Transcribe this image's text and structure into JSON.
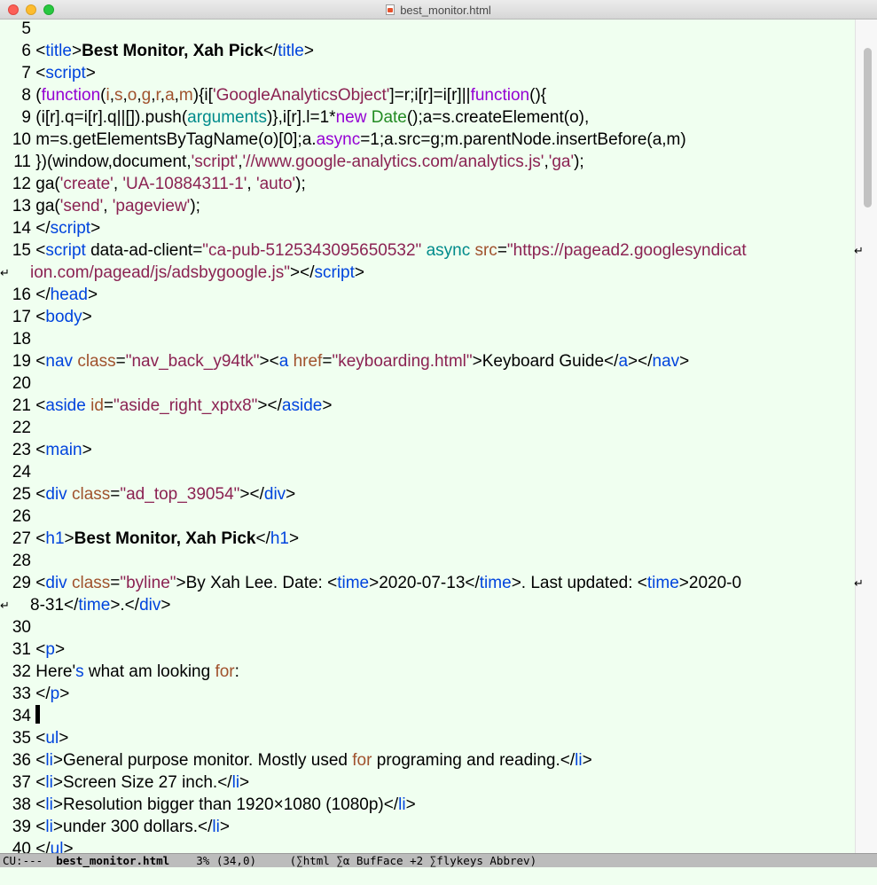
{
  "window": {
    "title": "best_monitor.html"
  },
  "colors": {
    "tag": "#0044dd",
    "attr": "#a0522d",
    "string": "#8b2252",
    "keyword": "#9400d3",
    "builtin": "#008b8b",
    "type": "#228b22",
    "text": "#000000"
  },
  "editor": {
    "cursor_line": "34",
    "lines": [
      {
        "n": "5",
        "segs": []
      },
      {
        "n": "6",
        "segs": [
          [
            "t",
            "<"
          ],
          [
            "tag",
            "title"
          ],
          [
            "t",
            ">"
          ],
          [
            "b",
            "Best Monitor, Xah Pick"
          ],
          [
            "t",
            "</"
          ],
          [
            "tag",
            "title"
          ],
          [
            "t",
            ">"
          ]
        ]
      },
      {
        "n": "7",
        "segs": [
          [
            "t",
            "<"
          ],
          [
            "tag",
            "script"
          ],
          [
            "t",
            ">"
          ]
        ]
      },
      {
        "n": "8",
        "segs": [
          [
            "t",
            "("
          ],
          [
            "kw",
            "function"
          ],
          [
            "t",
            "("
          ],
          [
            "attr",
            "i"
          ],
          [
            "t",
            ","
          ],
          [
            "attr",
            "s"
          ],
          [
            "t",
            ","
          ],
          [
            "attr",
            "o"
          ],
          [
            "t",
            ","
          ],
          [
            "attr",
            "g"
          ],
          [
            "t",
            ","
          ],
          [
            "attr",
            "r"
          ],
          [
            "t",
            ","
          ],
          [
            "attr",
            "a"
          ],
          [
            "t",
            ","
          ],
          [
            "attr",
            "m"
          ],
          [
            "t",
            "){i["
          ],
          [
            "str",
            "'GoogleAnalyticsObject'"
          ],
          [
            "t",
            "]=r;i[r]=i[r]||"
          ],
          [
            "kw",
            "function"
          ],
          [
            "t",
            "(){"
          ]
        ]
      },
      {
        "n": "9",
        "segs": [
          [
            "t",
            "(i[r].q=i[r].q||[]).push("
          ],
          [
            "bi",
            "arguments"
          ],
          [
            "t",
            ")},i[r].l=1*"
          ],
          [
            "kw",
            "new"
          ],
          [
            "t",
            " "
          ],
          [
            "ty",
            "Date"
          ],
          [
            "t",
            "();a=s.createElement(o),"
          ]
        ]
      },
      {
        "n": "10",
        "segs": [
          [
            "t",
            "m=s.getElementsByTagName(o)[0];a."
          ],
          [
            "kw",
            "async"
          ],
          [
            "t",
            "=1;a.src=g;m.parentNode.insertBefore(a,m)"
          ]
        ]
      },
      {
        "n": "11",
        "segs": [
          [
            "t",
            "})(window,document,"
          ],
          [
            "str",
            "'script'"
          ],
          [
            "t",
            ","
          ],
          [
            "str",
            "'//www.google-analytics.com/analytics.js'"
          ],
          [
            "t",
            ","
          ],
          [
            "str",
            "'ga'"
          ],
          [
            "t",
            ");"
          ]
        ]
      },
      {
        "n": "12",
        "segs": [
          [
            "t",
            "ga("
          ],
          [
            "str",
            "'create'"
          ],
          [
            "t",
            ", "
          ],
          [
            "str",
            "'UA-10884311-1'"
          ],
          [
            "t",
            ", "
          ],
          [
            "str",
            "'auto'"
          ],
          [
            "t",
            ");"
          ]
        ]
      },
      {
        "n": "13",
        "segs": [
          [
            "t",
            "ga("
          ],
          [
            "str",
            "'send'"
          ],
          [
            "t",
            ", "
          ],
          [
            "str",
            "'pageview'"
          ],
          [
            "t",
            ");"
          ]
        ]
      },
      {
        "n": "14",
        "segs": [
          [
            "t",
            "</"
          ],
          [
            "tag",
            "script"
          ],
          [
            "t",
            ">"
          ]
        ]
      },
      {
        "n": "15",
        "wrap": "right",
        "segs": [
          [
            "t",
            "<"
          ],
          [
            "tag",
            "script"
          ],
          [
            "t",
            " data-ad-client="
          ],
          [
            "str",
            "\"ca-pub-5125343095650532\""
          ],
          [
            "t",
            " "
          ],
          [
            "bi",
            "async"
          ],
          [
            "t",
            " "
          ],
          [
            "attr",
            "src"
          ],
          [
            "t",
            "="
          ],
          [
            "str",
            "\"https://pagead2.googlesyndicat"
          ]
        ]
      },
      {
        "n": "",
        "cont": true,
        "wrap": "left",
        "segs": [
          [
            "str",
            "ion.com/pagead/js/adsbygoogle.js\""
          ],
          [
            "t",
            "></"
          ],
          [
            "tag",
            "script"
          ],
          [
            "t",
            ">"
          ]
        ]
      },
      {
        "n": "16",
        "segs": [
          [
            "t",
            "</"
          ],
          [
            "tag",
            "head"
          ],
          [
            "t",
            ">"
          ]
        ]
      },
      {
        "n": "17",
        "segs": [
          [
            "t",
            "<"
          ],
          [
            "tag",
            "body"
          ],
          [
            "t",
            ">"
          ]
        ]
      },
      {
        "n": "18",
        "segs": []
      },
      {
        "n": "19",
        "segs": [
          [
            "t",
            "<"
          ],
          [
            "tag",
            "nav"
          ],
          [
            "t",
            " "
          ],
          [
            "attr",
            "class"
          ],
          [
            "t",
            "="
          ],
          [
            "str",
            "\"nav_back_y94tk\""
          ],
          [
            "t",
            "><"
          ],
          [
            "tag",
            "a"
          ],
          [
            "t",
            " "
          ],
          [
            "attr",
            "href"
          ],
          [
            "t",
            "="
          ],
          [
            "str",
            "\"keyboarding.html\""
          ],
          [
            "t",
            ">Keyboard Guide</"
          ],
          [
            "tag",
            "a"
          ],
          [
            "t",
            "></"
          ],
          [
            "tag",
            "nav"
          ],
          [
            "t",
            ">"
          ]
        ]
      },
      {
        "n": "20",
        "segs": []
      },
      {
        "n": "21",
        "segs": [
          [
            "t",
            "<"
          ],
          [
            "tag",
            "aside"
          ],
          [
            "t",
            " "
          ],
          [
            "attr",
            "id"
          ],
          [
            "t",
            "="
          ],
          [
            "str",
            "\"aside_right_xptx8\""
          ],
          [
            "t",
            "></"
          ],
          [
            "tag",
            "aside"
          ],
          [
            "t",
            ">"
          ]
        ]
      },
      {
        "n": "22",
        "segs": []
      },
      {
        "n": "23",
        "segs": [
          [
            "t",
            "<"
          ],
          [
            "tag",
            "main"
          ],
          [
            "t",
            ">"
          ]
        ]
      },
      {
        "n": "24",
        "segs": []
      },
      {
        "n": "25",
        "segs": [
          [
            "t",
            "<"
          ],
          [
            "tag",
            "div"
          ],
          [
            "t",
            " "
          ],
          [
            "attr",
            "class"
          ],
          [
            "t",
            "="
          ],
          [
            "str",
            "\"ad_top_39054\""
          ],
          [
            "t",
            "></"
          ],
          [
            "tag",
            "div"
          ],
          [
            "t",
            ">"
          ]
        ]
      },
      {
        "n": "26",
        "segs": []
      },
      {
        "n": "27",
        "segs": [
          [
            "t",
            "<"
          ],
          [
            "tag",
            "h1"
          ],
          [
            "t",
            ">"
          ],
          [
            "b",
            "Best Monitor, Xah Pick"
          ],
          [
            "t",
            "</"
          ],
          [
            "tag",
            "h1"
          ],
          [
            "t",
            ">"
          ]
        ]
      },
      {
        "n": "28",
        "segs": []
      },
      {
        "n": "29",
        "wrap": "right",
        "segs": [
          [
            "t",
            "<"
          ],
          [
            "tag",
            "div"
          ],
          [
            "t",
            " "
          ],
          [
            "attr",
            "class"
          ],
          [
            "t",
            "="
          ],
          [
            "str",
            "\"byline\""
          ],
          [
            "t",
            ">By Xah Lee. Date: <"
          ],
          [
            "tag",
            "time"
          ],
          [
            "t",
            ">2020-07-13</"
          ],
          [
            "tag",
            "time"
          ],
          [
            "t",
            ">. Last updated: <"
          ],
          [
            "tag",
            "time"
          ],
          [
            "t",
            ">2020-0"
          ]
        ]
      },
      {
        "n": "",
        "cont": true,
        "wrap": "left",
        "segs": [
          [
            "t",
            "8-31</"
          ],
          [
            "tag",
            "time"
          ],
          [
            "t",
            ">.</"
          ],
          [
            "tag",
            "div"
          ],
          [
            "t",
            ">"
          ]
        ]
      },
      {
        "n": "30",
        "segs": []
      },
      {
        "n": "31",
        "segs": [
          [
            "t",
            "<"
          ],
          [
            "tag",
            "p"
          ],
          [
            "t",
            ">"
          ]
        ]
      },
      {
        "n": "32",
        "segs": [
          [
            "t",
            "Here'"
          ],
          [
            "tag",
            "s"
          ],
          [
            "t",
            " what am looking "
          ],
          [
            "attr",
            "for"
          ],
          [
            "t",
            ":"
          ]
        ]
      },
      {
        "n": "33",
        "segs": [
          [
            "t",
            "</"
          ],
          [
            "tag",
            "p"
          ],
          [
            "t",
            ">"
          ]
        ]
      },
      {
        "n": "34",
        "segs": [
          [
            "cur",
            ""
          ]
        ]
      },
      {
        "n": "35",
        "segs": [
          [
            "t",
            "<"
          ],
          [
            "tag",
            "ul"
          ],
          [
            "t",
            ">"
          ]
        ]
      },
      {
        "n": "36",
        "segs": [
          [
            "t",
            "<"
          ],
          [
            "tag",
            "li"
          ],
          [
            "t",
            ">General purpose monitor. Mostly used "
          ],
          [
            "attr",
            "for"
          ],
          [
            "t",
            " programing and reading.</"
          ],
          [
            "tag",
            "li"
          ],
          [
            "t",
            ">"
          ]
        ]
      },
      {
        "n": "37",
        "segs": [
          [
            "t",
            "<"
          ],
          [
            "tag",
            "li"
          ],
          [
            "t",
            ">Screen Size 27 inch.</"
          ],
          [
            "tag",
            "li"
          ],
          [
            "t",
            ">"
          ]
        ]
      },
      {
        "n": "38",
        "segs": [
          [
            "t",
            "<"
          ],
          [
            "tag",
            "li"
          ],
          [
            "t",
            ">Resolution bigger than 1920×1080 (1080p)</"
          ],
          [
            "tag",
            "li"
          ],
          [
            "t",
            ">"
          ]
        ]
      },
      {
        "n": "39",
        "segs": [
          [
            "t",
            "<"
          ],
          [
            "tag",
            "li"
          ],
          [
            "t",
            ">under 300 dollars.</"
          ],
          [
            "tag",
            "li"
          ],
          [
            "t",
            ">"
          ]
        ]
      },
      {
        "n": "40",
        "segs": [
          [
            "t",
            "</"
          ],
          [
            "tag",
            "ul"
          ],
          [
            "t",
            ">"
          ]
        ]
      }
    ]
  },
  "modeline": {
    "status": "CU:---",
    "buffer": "best_monitor.html",
    "position": "3% (34,0)",
    "modes": "(∑html ∑α BufFace +2 ∑flykeys Abbrev)"
  }
}
